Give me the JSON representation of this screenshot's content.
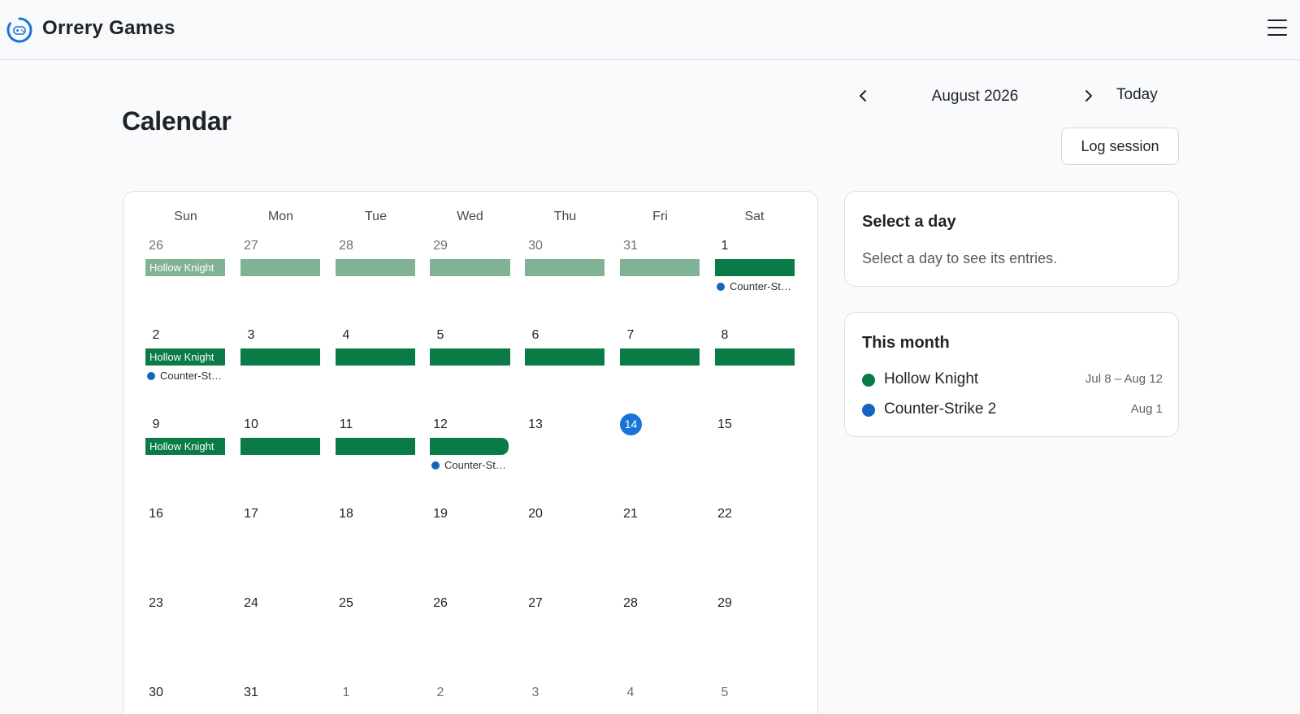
{
  "header": {
    "brand": "Orrery Games"
  },
  "page": {
    "title": "Calendar"
  },
  "nav": {
    "month_label": "August 2026",
    "today_label": "Today",
    "log_label": "Log session"
  },
  "calendar": {
    "weekdays": [
      "Sun",
      "Mon",
      "Tue",
      "Wed",
      "Thu",
      "Fri",
      "Sat"
    ],
    "weeks": [
      [
        "26",
        "27",
        "28",
        "29",
        "30",
        "31",
        "1"
      ],
      [
        "2",
        "3",
        "4",
        "5",
        "6",
        "7",
        "8"
      ],
      [
        "9",
        "10",
        "11",
        "12",
        "13",
        "14",
        "15"
      ],
      [
        "16",
        "17",
        "18",
        "19",
        "20",
        "21",
        "22"
      ],
      [
        "23",
        "24",
        "25",
        "26",
        "27",
        "28",
        "29"
      ],
      [
        "30",
        "31",
        "1",
        "2",
        "3",
        "4",
        "5"
      ]
    ],
    "today": "14",
    "bar_label": "Hollow Knight",
    "dot_label": "Counter-St…"
  },
  "select_day": {
    "title": "Select a day",
    "message": "Select a day to see its entries."
  },
  "this_month": {
    "title": "This month",
    "items": [
      {
        "name": "Hollow Knight",
        "range": "Jul 8 – Aug 12",
        "color": "#0a7a47"
      },
      {
        "name": "Counter-Strike 2",
        "range": "Aug 1",
        "color": "#1565c0"
      }
    ]
  },
  "colors": {
    "accent": "#1a73d9",
    "hollow_knight": "#0a7a47",
    "hollow_knight_faded": "#80b396",
    "counter_strike": "#1565c0"
  }
}
